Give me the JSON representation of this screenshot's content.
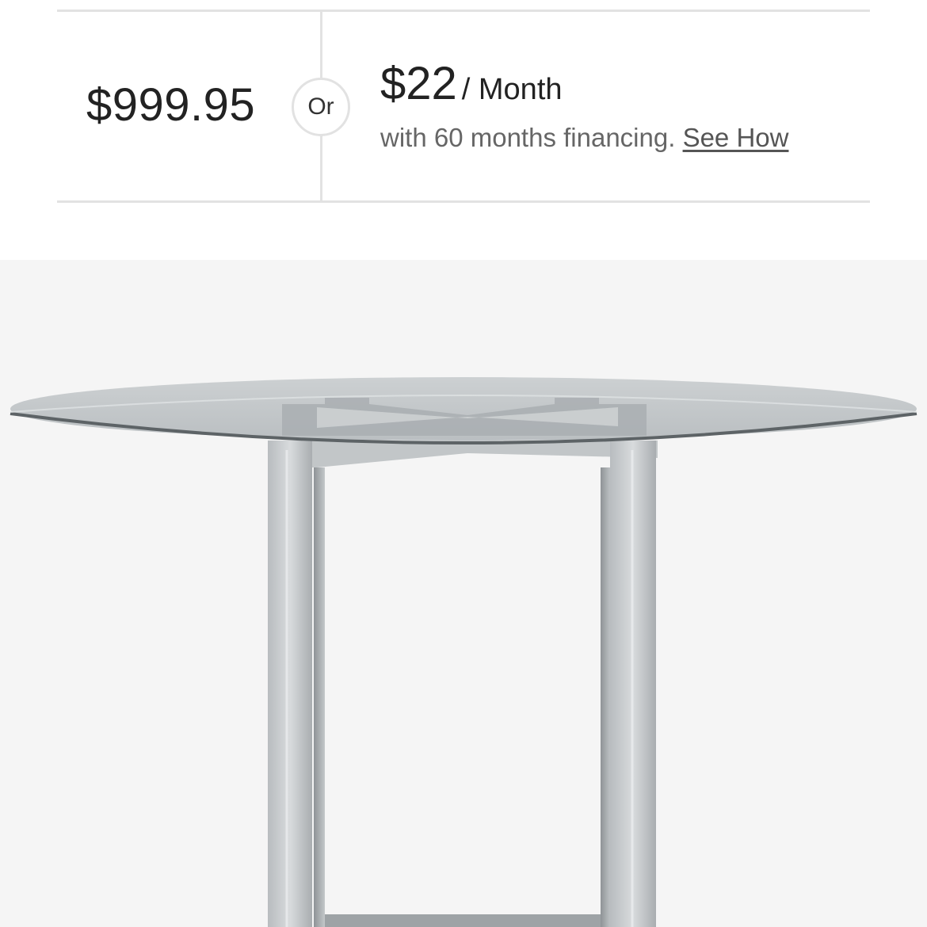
{
  "pricing": {
    "full_price": "$999.95",
    "or_label": "Or",
    "monthly_amount": "$22",
    "monthly_unit": "/ Month",
    "financing_text": "with 60 months financing.",
    "see_how_label": "See How"
  },
  "product_image": {
    "subject": "round glass top dining table with silver metal base",
    "background_color": "#f5f5f5"
  },
  "colors": {
    "text_primary": "#222222",
    "text_secondary": "#666666",
    "border": "#e2e2e2"
  }
}
